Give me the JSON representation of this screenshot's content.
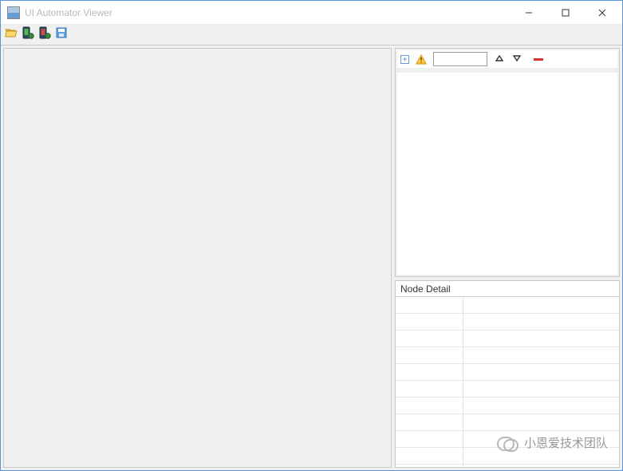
{
  "window": {
    "title": "UI Automator Viewer"
  },
  "toolbar": {
    "open_label": "open-file",
    "dump1_label": "device-screenshot",
    "dump2_label": "device-screenshot-compressed",
    "save_label": "save"
  },
  "tree": {
    "search_value": ""
  },
  "detail": {
    "header": "Node Detail"
  },
  "watermark": {
    "text": "小恩爱技术团队"
  }
}
